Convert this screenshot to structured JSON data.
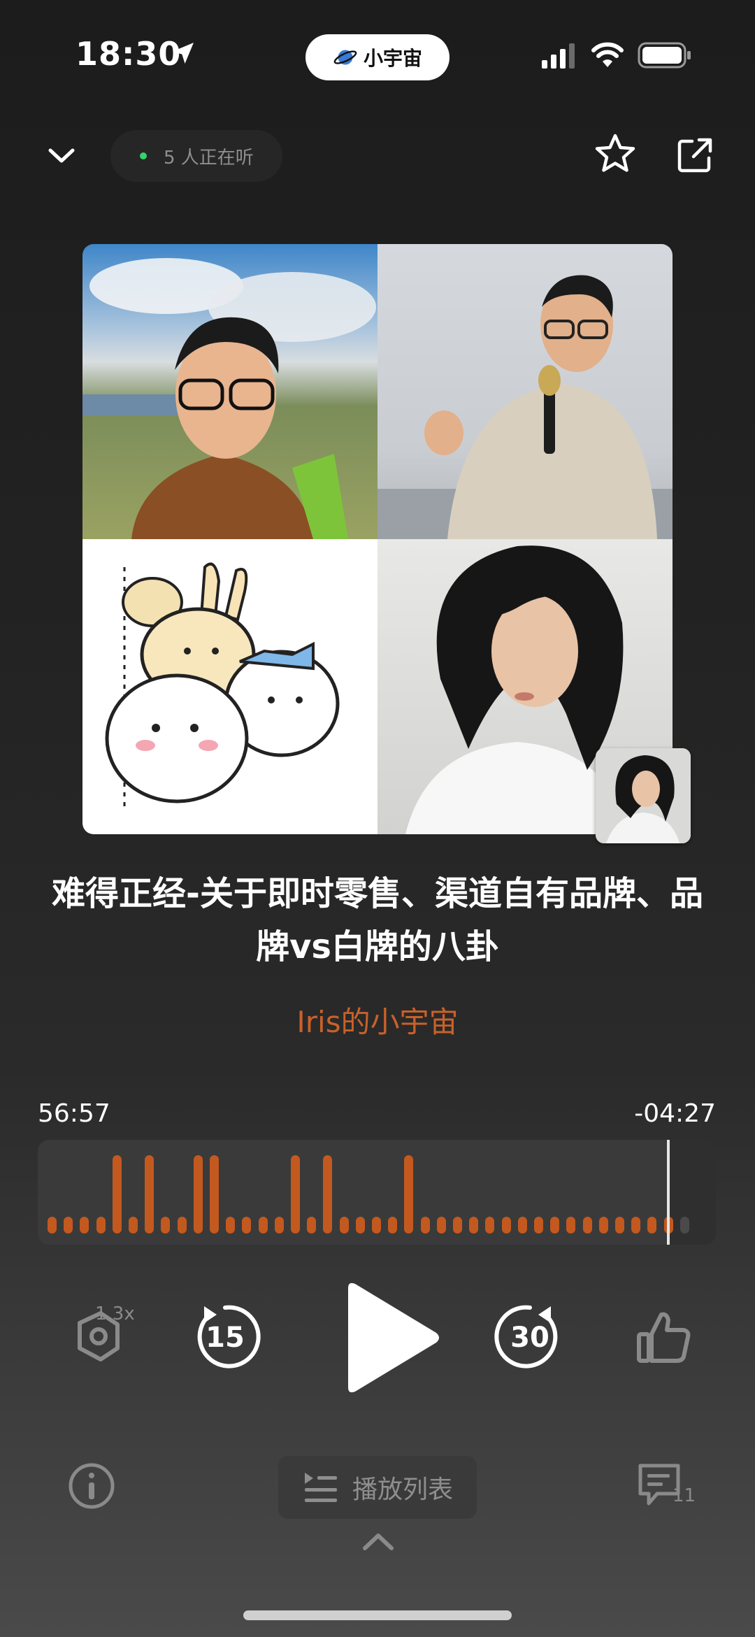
{
  "status_bar": {
    "time": "18:30",
    "app_pill": "小宇宙",
    "icons": [
      "location-arrow-icon",
      "signal-icon",
      "wifi-icon",
      "battery-icon"
    ]
  },
  "header": {
    "listeners": "5 人正在听",
    "icons": [
      "chevron-down-icon",
      "star-icon",
      "share-icon"
    ]
  },
  "episode": {
    "title": "难得正经-关于即时零售、渠道自有品牌、品牌vs白牌的八卦",
    "channel": "Iris的小宇宙"
  },
  "progress": {
    "elapsed": "56:57",
    "remaining": "-04:27",
    "played_fraction": 0.928
  },
  "controls": {
    "speed": "1.3x",
    "rewind": "15",
    "forward": "30",
    "icons": [
      "speed-icon",
      "rewind-15-icon",
      "play-icon",
      "forward-30-icon",
      "thumbs-up-icon"
    ]
  },
  "bottom": {
    "playlist_label": "播放列表",
    "comment_count": "11",
    "icons": [
      "info-icon",
      "playlist-icon",
      "comment-icon",
      "chevron-up-icon"
    ]
  },
  "colors": {
    "accent": "#c3591f",
    "channel": "#c8612a",
    "live_dot": "#35d36a"
  }
}
